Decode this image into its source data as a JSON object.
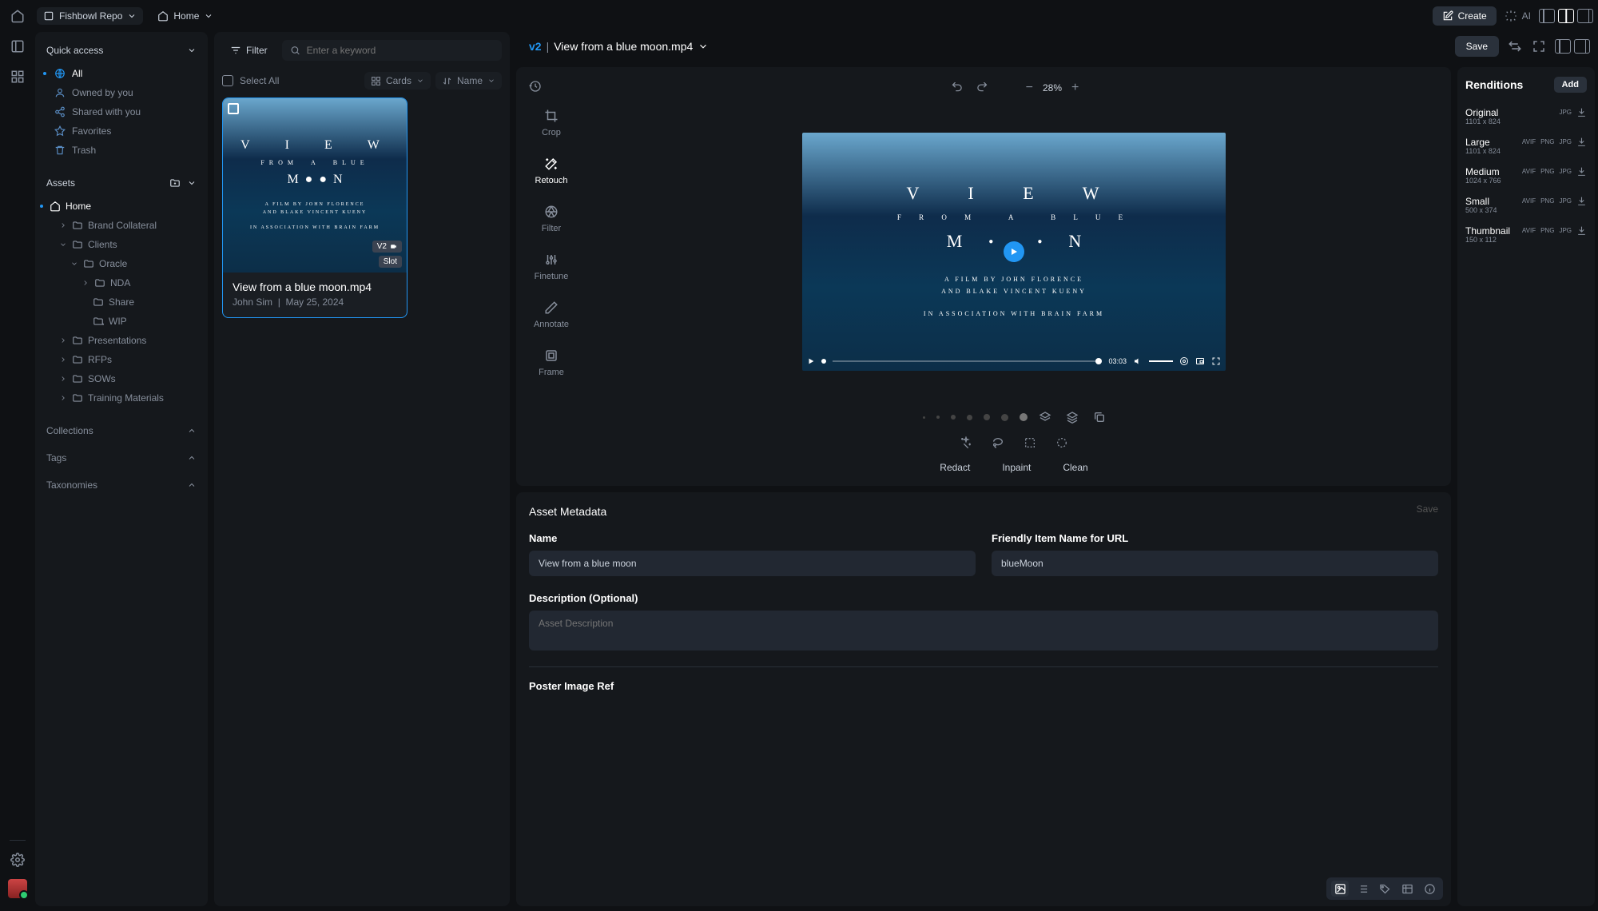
{
  "header": {
    "repo": "Fishbowl Repo",
    "crumb": "Home",
    "create": "Create",
    "ai": "AI"
  },
  "sidebar": {
    "quick_access": "Quick access",
    "items": [
      {
        "label": "All"
      },
      {
        "label": "Owned by you"
      },
      {
        "label": "Shared with you"
      },
      {
        "label": "Favorites"
      },
      {
        "label": "Trash"
      }
    ],
    "assets": "Assets",
    "tree": {
      "home": "Home",
      "brand": "Brand Collateral",
      "clients": "Clients",
      "oracle": "Oracle",
      "nda": "NDA",
      "share": "Share",
      "wip": "WIP",
      "pres": "Presentations",
      "rfps": "RFPs",
      "sows": "SOWs",
      "train": "Training Materials"
    },
    "collections": "Collections",
    "tags": "Tags",
    "taxonomies": "Taxonomies"
  },
  "browser": {
    "filter": "Filter",
    "search_placeholder": "Enter a keyword",
    "select_all": "Select All",
    "view_mode": "Cards",
    "sort": "Name",
    "card": {
      "title": "View from a blue moon.mp4",
      "author": "John Sim",
      "date": "May 25, 2024",
      "version": "V2",
      "slot": "Slot"
    }
  },
  "preview": {
    "version": "v2",
    "filename": "View from a blue moon.mp4",
    "save": "Save",
    "zoom": "28%",
    "tools": [
      {
        "label": "Crop"
      },
      {
        "label": "Retouch"
      },
      {
        "label": "Filter"
      },
      {
        "label": "Finetune"
      },
      {
        "label": "Annotate"
      },
      {
        "label": "Frame"
      }
    ],
    "video_time": "03:03",
    "ai_actions": {
      "redact": "Redact",
      "inpaint": "Inpaint",
      "clean": "Clean"
    }
  },
  "metadata": {
    "heading": "Asset Metadata",
    "save": "Save",
    "name_label": "Name",
    "name_value": "View from a blue moon",
    "url_label": "Friendly Item Name for URL",
    "url_value": "blueMoon",
    "desc_label": "Description (Optional)",
    "desc_placeholder": "Asset Description",
    "poster_label": "Poster Image Ref"
  },
  "renditions": {
    "heading": "Renditions",
    "add": "Add",
    "items": [
      {
        "name": "Original",
        "dims": "1101 x 824",
        "formats": [
          "JPG"
        ]
      },
      {
        "name": "Large",
        "dims": "1101 x 824",
        "formats": [
          "AVIF",
          "PNG",
          "JPG"
        ]
      },
      {
        "name": "Medium",
        "dims": "1024 x 766",
        "formats": [
          "AVIF",
          "PNG",
          "JPG"
        ]
      },
      {
        "name": "Small",
        "dims": "500 x 374",
        "formats": [
          "AVIF",
          "PNG",
          "JPG"
        ]
      },
      {
        "name": "Thumbnail",
        "dims": "150 x 112",
        "formats": [
          "AVIF",
          "PNG",
          "JPG"
        ]
      }
    ]
  }
}
